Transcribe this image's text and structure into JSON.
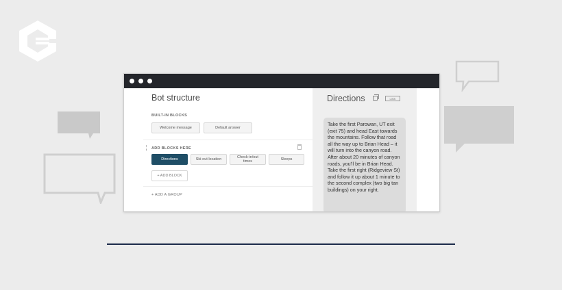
{
  "colors": {
    "background": "#ececec",
    "titlebar": "#24262b",
    "active_button": "#1f4e66",
    "rule": "#1b2a4a",
    "bubble_gray": "#cfcfcf"
  },
  "icons": {
    "logo": "brand-c-logo-icon",
    "copy": "copy-icon",
    "delete": "trash-icon",
    "drag": "drag-handle-icon"
  },
  "bot_structure": {
    "title": "Bot structure",
    "built_in_label": "BUILT-IN BLOCKS",
    "built_in_blocks": [
      "Welcome message",
      "Default answer"
    ],
    "add_blocks_label": "ADD BLOCKS HERE",
    "blocks": [
      "Directions",
      "Ski-out location",
      "Check-in/out times",
      "Sleeps"
    ],
    "active_block": "Directions",
    "add_block": "+ ADD BLOCK",
    "add_group": "+ ADD A GROUP"
  },
  "detail": {
    "title": "Directions",
    "link_label": "LINK",
    "message": "Take the first Parowan, UT exit (exit 75) and head East towards the mountains. Follow that road all the way up to Brian Head – it will turn into the canyon road. After about 20 minutes of canyon roads, you'll be in Brian Head. Take the first right (Ridgeview St) and follow it up about 1 minute to the second complex (two big tan buildings) on your right."
  }
}
